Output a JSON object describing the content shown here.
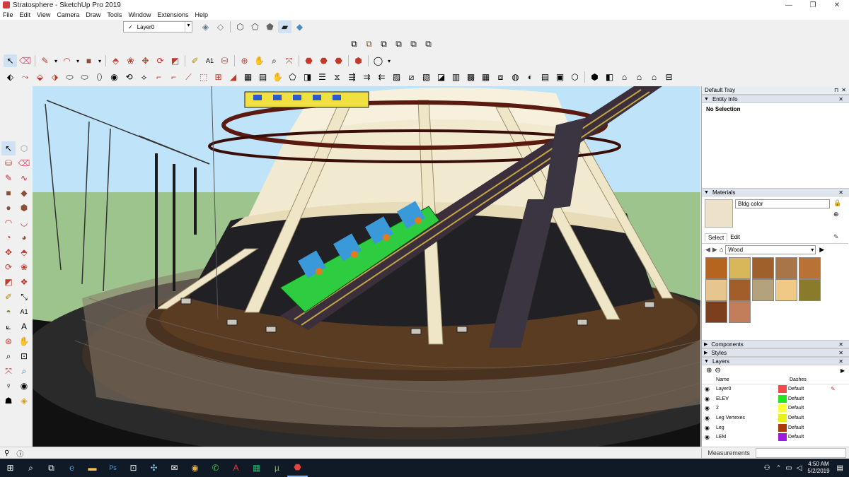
{
  "window": {
    "title": "Stratosphere - SketchUp Pro 2019",
    "minimize": "—",
    "maximize": "❐",
    "close": "✕"
  },
  "menu": [
    "File",
    "Edit",
    "View",
    "Camera",
    "Draw",
    "Tools",
    "Window",
    "Extensions",
    "Help"
  ],
  "layer_toolbar": {
    "check": "✓",
    "current_layer": "Layer0"
  },
  "tray": {
    "title": "Default Tray",
    "entity_info": {
      "title": "Entity Info",
      "status": "No Selection"
    },
    "materials": {
      "title": "Materials",
      "name_value": "Bldg color",
      "tab_select": "Select",
      "tab_edit": "Edit",
      "library": "Wood",
      "current_color": "#ede1c9",
      "swatches": [
        "#b5651d",
        "#d8b65a",
        "#a0602c",
        "#a87646",
        "#b87236",
        "#e6c58e",
        "#a15d2a",
        "#b3a27c",
        "#f0c987",
        "#8a7a2c",
        "#7b3f1d",
        "#c27e5a"
      ]
    },
    "collapsed_panels": [
      "Components",
      "Styles"
    ],
    "layers": {
      "title": "Layers",
      "col_name": "Name",
      "col_dashes": "Dashes",
      "rows": [
        {
          "name": "Layer0",
          "color": "#ef4b4b",
          "dashes": "Default",
          "current": true
        },
        {
          "name": "ELEV",
          "color": "#21e621",
          "dashes": "Default",
          "current": false
        },
        {
          "name": "2",
          "color": "#ffff33",
          "dashes": "Default",
          "current": false
        },
        {
          "name": "Leg Vertexes",
          "color": "#e8f21a",
          "dashes": "Default",
          "current": false
        },
        {
          "name": "Leg",
          "color": "#a83a0c",
          "dashes": "Default",
          "current": false
        },
        {
          "name": "LEM",
          "color": "#9c19e0",
          "dashes": "Default",
          "current": false
        }
      ]
    }
  },
  "status": {
    "measurements": "Measurements"
  },
  "taskbar": {
    "time": "4:50 AM",
    "date": "5/2/2019"
  }
}
